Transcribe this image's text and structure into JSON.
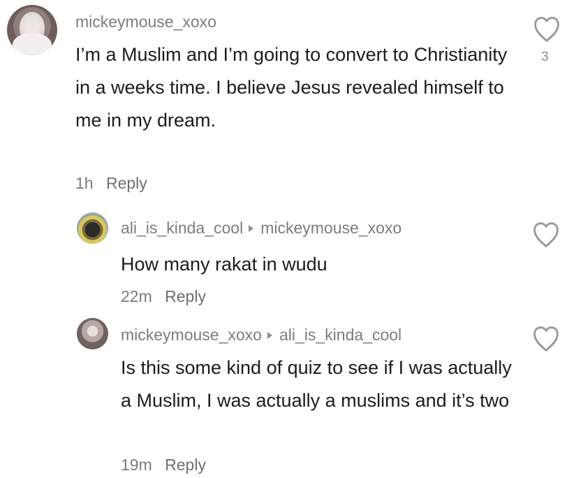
{
  "comments": [
    {
      "username": "mickeymouse_xoxo",
      "text": "I’m a Muslim and I’m going to convert to Christianity in a weeks time. I believe Jesus revealed himself to me in my dream.",
      "time": "1h",
      "reply_label": "Reply",
      "like_count": "3"
    },
    {
      "username": "ali_is_kinda_cool",
      "reply_to": "mickeymouse_xoxo",
      "text": "How many rakat in wudu",
      "time": "22m",
      "reply_label": "Reply"
    },
    {
      "username": "mickeymouse_xoxo",
      "reply_to": "ali_is_kinda_cool",
      "text": "Is this some kind of quiz to see if I was actually a Muslim, I was actually a muslims and it’s two",
      "time": "19m",
      "reply_label": "Reply"
    }
  ]
}
